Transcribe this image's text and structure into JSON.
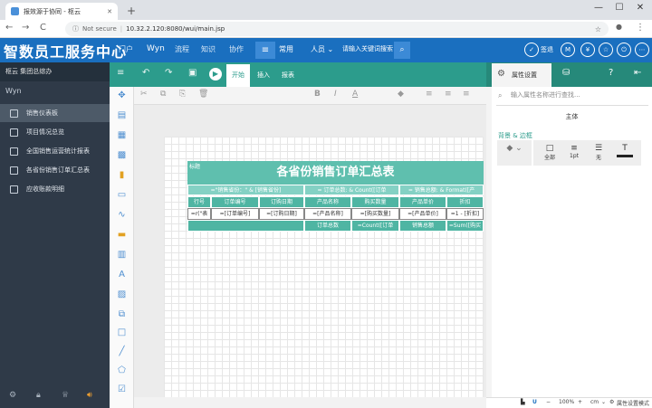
{
  "browser": {
    "tab_title": "报效源于协同 - 枢云",
    "new_tab": "+",
    "not_secure": "Not secure",
    "url": "10.32.2.120:8080/wui/main.jsp",
    "win_min": "—",
    "win_max": "☐",
    "win_close": "✕",
    "back": "←",
    "forward": "→",
    "reload": "C",
    "star": "☆",
    "profile": "●",
    "menu": "⋮"
  },
  "header": {
    "brand": "智数员工服务中心",
    "menu": [
      "门户",
      "Wyn",
      "流程",
      "知识",
      "协作"
    ],
    "active_menu": "常用",
    "people": "人员",
    "search_placeholder": "请输入关键词搜索",
    "signin": "签退",
    "user": "M",
    "yen": "¥"
  },
  "sidebar": {
    "org": "枢云 集团总综办",
    "wyn": "Wyn",
    "items": [
      "销售仪表板",
      "项目情况总览",
      "全国销售运营统计报表",
      "各省份销售订单汇总表",
      "应收账款明细"
    ]
  },
  "toolbar": {
    "tabs": [
      "开始",
      "插入",
      "报表"
    ],
    "properties": "属性设置"
  },
  "report": {
    "title": "各省份销售订单汇总表",
    "title_tag": "标题",
    "group_row": [
      "=\"销售省份：\" & [销售省份]",
      "= \"订单总数：\" & Count([订单编号])",
      "= \"销售总额：\" & Format(Sum([销售额]),\"C\")"
    ],
    "group_cut": [
      "= 订单总数: & Count([订单",
      "= 销售总额: & Format([产"
    ],
    "headers": [
      "行号",
      "订单编号",
      "订购日期",
      "产品名称",
      "购买数量",
      "产品单价",
      "折扣"
    ],
    "details": [
      "=r(\"表",
      "=[订单编号]",
      "=[订购日期]",
      "=[产品名称]",
      "=[购买数量]",
      "=[产品单价]",
      "=1 - [折扣]"
    ],
    "footer": [
      "订单总数",
      "=Count([订单",
      "销售总额",
      "=Sum([购买"
    ]
  },
  "panel": {
    "search_placeholder": "输入属性名称进行查找...",
    "subject": "主体",
    "section": "背景 & 边框",
    "btns": [
      "全部",
      "1pt",
      "无",
      ""
    ]
  },
  "status": {
    "zoom": "100%",
    "unit": "cm",
    "mode": "属性设置模式"
  }
}
